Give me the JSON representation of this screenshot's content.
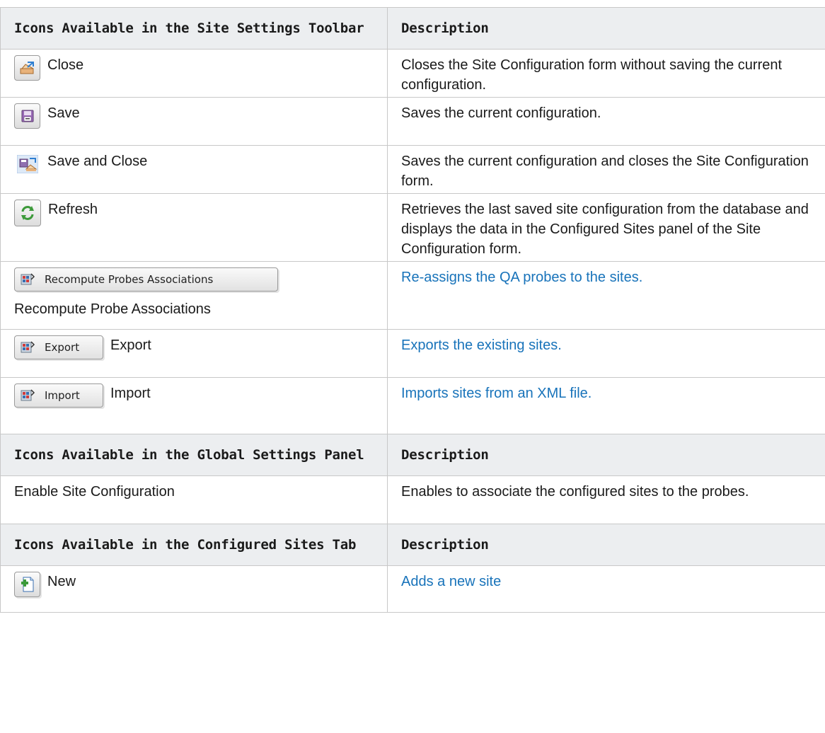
{
  "toolbar_section": {
    "header_col1": "Icons Available in the Site Settings Toolbar",
    "header_col2": "Description",
    "rows": [
      {
        "icon": "close-icon",
        "label": "Close",
        "description": "Closes the Site Configuration form without saving the current configuration."
      },
      {
        "icon": "save-icon",
        "label": "Save",
        "description": "Saves the current configuration."
      },
      {
        "icon": "save-and-close-icon",
        "label": "Save and Close",
        "description": "Saves the current configuration and closes the Site Configuration form."
      },
      {
        "icon": "refresh-icon",
        "label": "Refresh",
        "description": "Retrieves the last saved site configuration from the database and displays the data in the Configured Sites panel of the Site Configuration form."
      },
      {
        "icon": "recompute-icon",
        "button_text": "Recompute Probes Associations",
        "label": "Recompute Probe Associations",
        "description": "Re-assigns the QA probes to the sites."
      },
      {
        "icon": "export-icon",
        "button_text": "Export",
        "label": "Export",
        "description": "Exports the existing sites."
      },
      {
        "icon": "import-icon",
        "button_text": "Import",
        "label": "Import",
        "description": "Imports sites from an XML file."
      }
    ]
  },
  "global_section": {
    "header_col1": "Icons Available in the Global Settings Panel",
    "header_col2": "Description",
    "rows": [
      {
        "label": "Enable Site Configuration",
        "description": "Enables to associate the configured sites to the probes."
      }
    ]
  },
  "sites_section": {
    "header_col1": "Icons Available in the Configured Sites Tab",
    "header_col2": "Description",
    "rows": [
      {
        "icon": "new-site-icon",
        "label": "New",
        "description": "Adds a new site"
      }
    ]
  },
  "colors": {
    "header_bg": "#eceef0",
    "link": "#1873ba",
    "border": "#c8c8c8"
  }
}
